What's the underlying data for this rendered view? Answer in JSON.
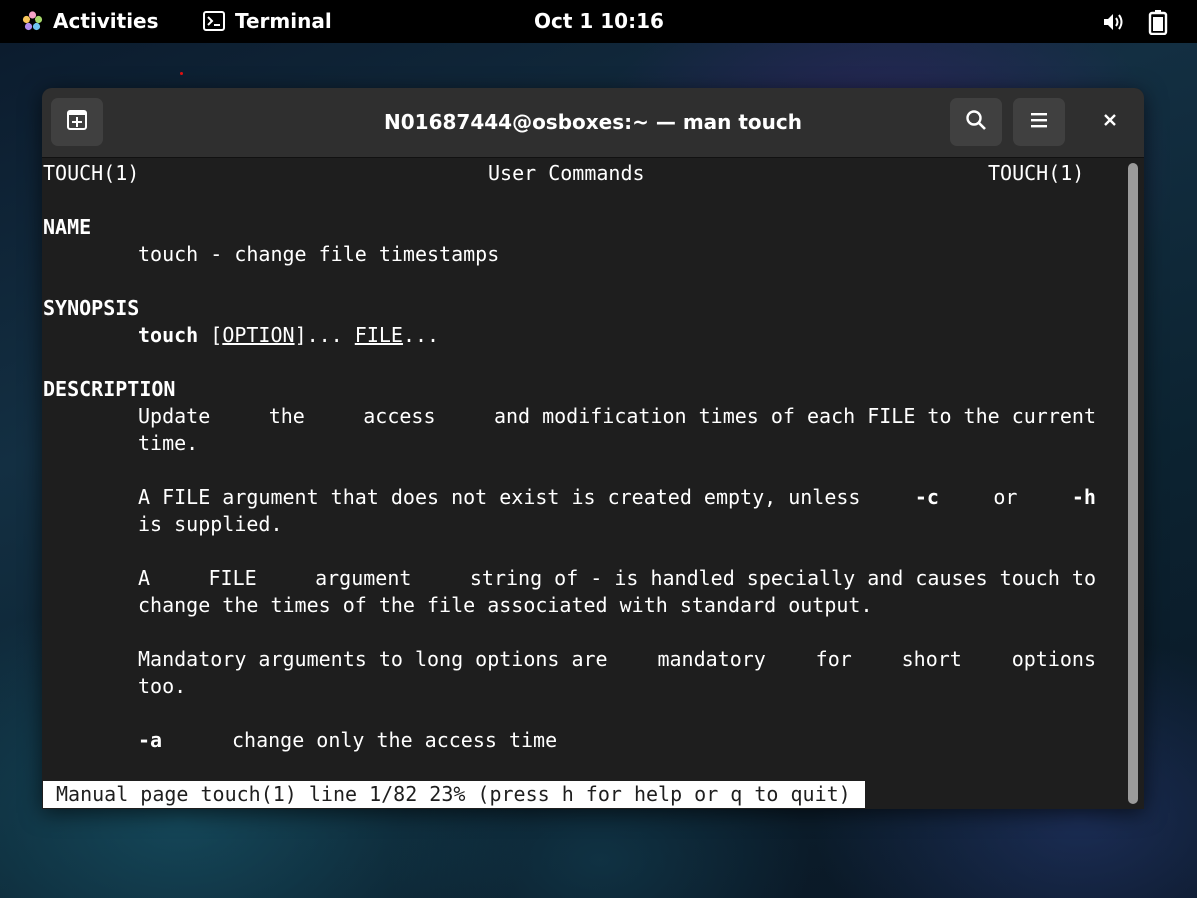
{
  "topbar": {
    "activities": "Activities",
    "app_name": "Terminal",
    "clock": "Oct 1  10:16"
  },
  "window": {
    "title": "N01687444@osboxes:~ — man touch"
  },
  "manpage": {
    "header_left": "TOUCH(1)",
    "header_center": "User Commands",
    "header_right": "TOUCH(1)",
    "name_heading": "NAME",
    "name_text": "touch - change file timestamps",
    "synopsis_heading": "SYNOPSIS",
    "synopsis_cmd": "touch",
    "synopsis_open": " [",
    "synopsis_option": "OPTION",
    "synopsis_mid": "]... ",
    "synopsis_file": "FILE",
    "synopsis_end": "...",
    "description_heading": "DESCRIPTION",
    "p1_line1_words": [
      "Update",
      "the",
      "access",
      "and modification times of each FILE to the current"
    ],
    "p1_line2": "time.",
    "p2_line1_text": "A FILE argument that does not exist is created empty, unless",
    "p2_line1_c": "-c",
    "p2_line1_or": "or",
    "p2_line1_h": "-h",
    "p2_line2": "is supplied.",
    "p3_line1_words": [
      "A",
      "FILE",
      "argument",
      "string of - is handled specially and causes touch to"
    ],
    "p3_line2": "change the times of the file associated with standard output.",
    "p4_line1_words": [
      "Mandatory arguments to long options are",
      "mandatory",
      "for",
      "short",
      "options"
    ],
    "p4_line2": "too.",
    "opt_a_flag": "-a",
    "opt_a_desc": "change only the access time"
  },
  "status_line": "Manual page touch(1) line 1/82 23% (press h for help or q to quit)",
  "colors": {
    "terminal_bg": "#1e1e1e",
    "headerbar_bg": "#2f2f2f",
    "topbar_bg": "#000000"
  },
  "icons": [
    "activities-logo-icon",
    "terminal-app-icon",
    "new-tab-icon",
    "search-icon",
    "hamburger-menu-icon",
    "close-icon",
    "volume-icon",
    "battery-icon"
  ]
}
